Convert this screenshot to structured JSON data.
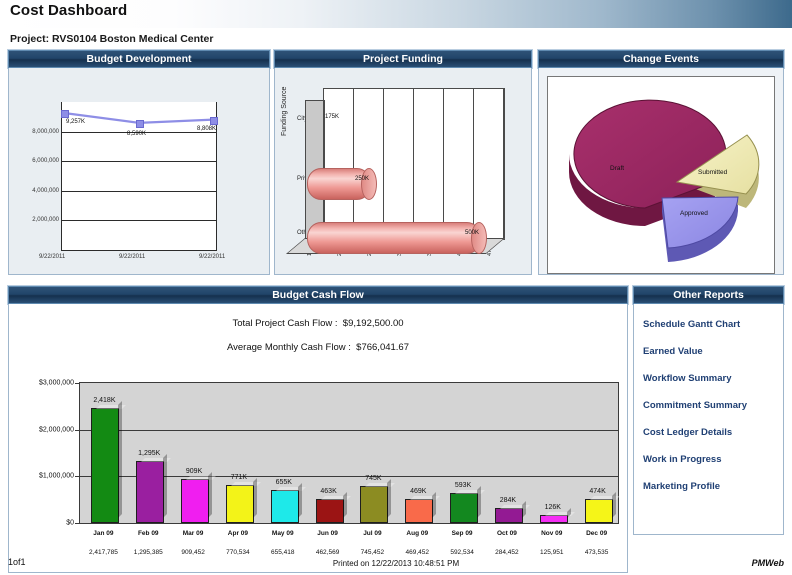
{
  "header": {
    "title": "Cost Dashboard",
    "project_line": "Project: RVS0104 Boston Medical Center"
  },
  "panels": {
    "budget_development": "Budget Development",
    "project_funding": "Project Funding",
    "change_events": "Change Events",
    "budget_cash_flow": "Budget Cash Flow",
    "other_reports": "Other Reports"
  },
  "cash_flow_summary": {
    "total_label": "Total Project Cash Flow :",
    "total_value": "$9,192,500.00",
    "average_label": "Average Monthly Cash Flow :",
    "average_value": "$766,041.67"
  },
  "other_reports": {
    "links": [
      "Schedule Gantt Chart",
      "Earned Value",
      "Workflow Summary",
      "Commitment Summary",
      "Cost Ledger Details",
      "Work in Progress",
      "Marketing Profile"
    ]
  },
  "footer": {
    "page": "1of1",
    "printed": "Printed on 12/22/2013 10:48:51 PM",
    "brand": "PMWeb"
  },
  "chart_data": [
    {
      "id": "budget-development",
      "type": "line",
      "title": "Budget Development",
      "x": [
        "9/22/2011",
        "9/22/2011",
        "9/22/2011"
      ],
      "values": [
        9257000,
        8590000,
        8808000
      ],
      "data_labels": [
        "9,257K",
        "8,590K",
        "8,808K"
      ],
      "ylabel": "",
      "xlabel": "",
      "ylim": [
        0,
        10000000
      ],
      "yticks": [
        2000000,
        4000000,
        6000000,
        8000000
      ],
      "ytick_labels": [
        "2,000,000",
        "4,000,000",
        "6,000,000",
        "8,000,000"
      ],
      "series_color": "#8e8ee6",
      "grid": true,
      "legend": "none"
    },
    {
      "id": "project-funding",
      "type": "bar",
      "orientation": "horizontal",
      "title": "Project Funding",
      "ylabel": "Funding Source",
      "xlabel": "",
      "categories": [
        "City",
        "Private",
        "Other"
      ],
      "values": [
        175000,
        250000,
        500000
      ],
      "data_labels": [
        "175K",
        "250K",
        "500K"
      ],
      "xticks": [
        175000,
        225000,
        275000,
        325000,
        375000,
        425000,
        475000
      ],
      "xtick_labels": [
        "175,000",
        "225,000",
        "275,000",
        "325,000",
        "375,000",
        "425,000",
        "475,000"
      ],
      "bar_color": "#ef9a95",
      "grid": true,
      "legend": "none"
    },
    {
      "id": "change-events",
      "type": "pie",
      "title": "Change Events",
      "labels": [
        "Draft",
        "Submitted",
        "Approved"
      ],
      "values": [
        50,
        25,
        25
      ],
      "colors": [
        "#9c2a62",
        "#f0ecb4",
        "#9a96e8"
      ],
      "legend": "none"
    },
    {
      "id": "budget-cash-flow",
      "type": "bar",
      "title": "Budget Cash Flow",
      "categories": [
        "Jan 09",
        "Feb 09",
        "Mar 09",
        "Apr 09",
        "May 09",
        "Jun 09",
        "Jul 09",
        "Aug 09",
        "Sep 09",
        "Oct 09",
        "Nov 09",
        "Dec 09"
      ],
      "values": [
        2417785,
        1295385,
        909452,
        770534,
        655418,
        462569,
        745452,
        469452,
        592534,
        284452,
        125951,
        473535
      ],
      "data_labels": [
        "2,418K",
        "1,295K",
        "909K",
        "771K",
        "655K",
        "463K",
        "745K",
        "469K",
        "593K",
        "284K",
        "126K",
        "474K"
      ],
      "value_labels": [
        "2,417,785",
        "1,295,385",
        "909,452",
        "770,534",
        "655,418",
        "462,569",
        "745,452",
        "469,452",
        "592,534",
        "284,452",
        "125,951",
        "473,535"
      ],
      "bar_colors": [
        "#138a13",
        "#9a1fa0",
        "#f01ef0",
        "#f3f318",
        "#1ee9e9",
        "#9b1414",
        "#8c8c22",
        "#f96a4a",
        "#13881f",
        "#931a93",
        "#f52ef5",
        "#f5f518"
      ],
      "ylabel": "",
      "xlabel": "",
      "ylim": [
        0,
        3000000
      ],
      "yticks": [
        0,
        1000000,
        2000000,
        3000000
      ],
      "ytick_labels": [
        "$0",
        "$1,000,000",
        "$2,000,000",
        "$3,000,000"
      ],
      "grid": true,
      "legend": "none"
    }
  ]
}
